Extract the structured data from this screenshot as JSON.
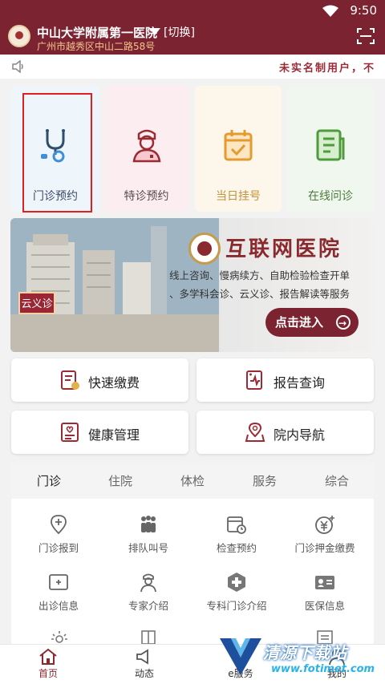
{
  "status": {
    "time": "9:50"
  },
  "header": {
    "title": "中山大学附属第一医院",
    "switch_label": "[切换]",
    "address": "广州市越秀区中山二路58号"
  },
  "notice": {
    "text": "未实名制用户，不"
  },
  "tiles": [
    {
      "label": "门诊预约",
      "icon": "stethoscope-icon"
    },
    {
      "label": "特诊预约",
      "icon": "doctor-icon"
    },
    {
      "label": "当日挂号",
      "icon": "calendar-check-icon"
    },
    {
      "label": "在线问诊",
      "icon": "document-icon"
    }
  ],
  "banner": {
    "title": "互联网医院",
    "line1": "线上咨询、慢病续方、自助检验检查开单",
    "line2": "、多学科会诊、云义诊、报告解读等服务",
    "button_label": "点击进入",
    "tag": "云义诊"
  },
  "cards": [
    {
      "label": "快速缴费",
      "icon": "payment-icon"
    },
    {
      "label": "报告查询",
      "icon": "report-icon"
    },
    {
      "label": "健康管理",
      "icon": "health-icon"
    },
    {
      "label": "院内导航",
      "icon": "map-pin-icon"
    }
  ],
  "tabs": [
    "门诊",
    "住院",
    "体检",
    "服务",
    "综合"
  ],
  "grid": [
    {
      "label": "门诊报到",
      "icon": "checkin-icon"
    },
    {
      "label": "排队叫号",
      "icon": "queue-icon"
    },
    {
      "label": "检查预约",
      "icon": "calendar-clock-icon"
    },
    {
      "label": "门诊押金缴费",
      "icon": "yuan-plus-icon"
    },
    {
      "label": "出诊信息",
      "icon": "schedule-icon"
    },
    {
      "label": "专家介绍",
      "icon": "expert-icon"
    },
    {
      "label": "专科门诊介绍",
      "icon": "cross-badge-icon"
    },
    {
      "label": "医保信息",
      "icon": "id-card-icon"
    }
  ],
  "bottom_nav": [
    {
      "label": "首页",
      "icon": "home-icon"
    },
    {
      "label": "动态",
      "icon": "megaphone-icon"
    },
    {
      "label": "e服务",
      "icon": "e-service-icon"
    },
    {
      "label": "我的",
      "icon": "user-icon"
    }
  ],
  "watermark": {
    "title": "清源下载站",
    "url": "www.fotimet.com"
  },
  "colors": {
    "brand": "#7b2331",
    "accent_gold": "#f3c88c",
    "alert_red": "#e02020"
  }
}
